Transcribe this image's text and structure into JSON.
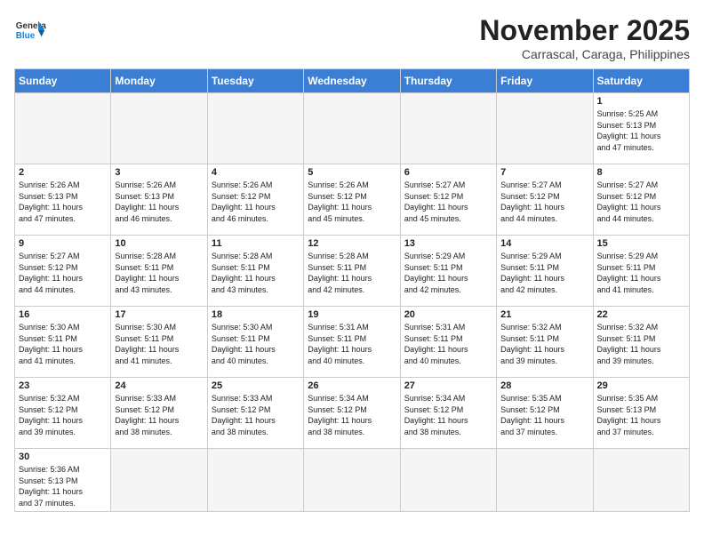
{
  "header": {
    "logo_general": "General",
    "logo_blue": "Blue",
    "month": "November 2025",
    "location": "Carrascal, Caraga, Philippines"
  },
  "weekdays": [
    "Sunday",
    "Monday",
    "Tuesday",
    "Wednesday",
    "Thursday",
    "Friday",
    "Saturday"
  ],
  "weeks": [
    [
      {
        "day": "",
        "info": ""
      },
      {
        "day": "",
        "info": ""
      },
      {
        "day": "",
        "info": ""
      },
      {
        "day": "",
        "info": ""
      },
      {
        "day": "",
        "info": ""
      },
      {
        "day": "",
        "info": ""
      },
      {
        "day": "1",
        "info": "Sunrise: 5:25 AM\nSunset: 5:13 PM\nDaylight: 11 hours\nand 47 minutes."
      }
    ],
    [
      {
        "day": "2",
        "info": "Sunrise: 5:26 AM\nSunset: 5:13 PM\nDaylight: 11 hours\nand 47 minutes."
      },
      {
        "day": "3",
        "info": "Sunrise: 5:26 AM\nSunset: 5:13 PM\nDaylight: 11 hours\nand 46 minutes."
      },
      {
        "day": "4",
        "info": "Sunrise: 5:26 AM\nSunset: 5:12 PM\nDaylight: 11 hours\nand 46 minutes."
      },
      {
        "day": "5",
        "info": "Sunrise: 5:26 AM\nSunset: 5:12 PM\nDaylight: 11 hours\nand 45 minutes."
      },
      {
        "day": "6",
        "info": "Sunrise: 5:27 AM\nSunset: 5:12 PM\nDaylight: 11 hours\nand 45 minutes."
      },
      {
        "day": "7",
        "info": "Sunrise: 5:27 AM\nSunset: 5:12 PM\nDaylight: 11 hours\nand 44 minutes."
      },
      {
        "day": "8",
        "info": "Sunrise: 5:27 AM\nSunset: 5:12 PM\nDaylight: 11 hours\nand 44 minutes."
      }
    ],
    [
      {
        "day": "9",
        "info": "Sunrise: 5:27 AM\nSunset: 5:12 PM\nDaylight: 11 hours\nand 44 minutes."
      },
      {
        "day": "10",
        "info": "Sunrise: 5:28 AM\nSunset: 5:11 PM\nDaylight: 11 hours\nand 43 minutes."
      },
      {
        "day": "11",
        "info": "Sunrise: 5:28 AM\nSunset: 5:11 PM\nDaylight: 11 hours\nand 43 minutes."
      },
      {
        "day": "12",
        "info": "Sunrise: 5:28 AM\nSunset: 5:11 PM\nDaylight: 11 hours\nand 42 minutes."
      },
      {
        "day": "13",
        "info": "Sunrise: 5:29 AM\nSunset: 5:11 PM\nDaylight: 11 hours\nand 42 minutes."
      },
      {
        "day": "14",
        "info": "Sunrise: 5:29 AM\nSunset: 5:11 PM\nDaylight: 11 hours\nand 42 minutes."
      },
      {
        "day": "15",
        "info": "Sunrise: 5:29 AM\nSunset: 5:11 PM\nDaylight: 11 hours\nand 41 minutes."
      }
    ],
    [
      {
        "day": "16",
        "info": "Sunrise: 5:30 AM\nSunset: 5:11 PM\nDaylight: 11 hours\nand 41 minutes."
      },
      {
        "day": "17",
        "info": "Sunrise: 5:30 AM\nSunset: 5:11 PM\nDaylight: 11 hours\nand 41 minutes."
      },
      {
        "day": "18",
        "info": "Sunrise: 5:30 AM\nSunset: 5:11 PM\nDaylight: 11 hours\nand 40 minutes."
      },
      {
        "day": "19",
        "info": "Sunrise: 5:31 AM\nSunset: 5:11 PM\nDaylight: 11 hours\nand 40 minutes."
      },
      {
        "day": "20",
        "info": "Sunrise: 5:31 AM\nSunset: 5:11 PM\nDaylight: 11 hours\nand 40 minutes."
      },
      {
        "day": "21",
        "info": "Sunrise: 5:32 AM\nSunset: 5:11 PM\nDaylight: 11 hours\nand 39 minutes."
      },
      {
        "day": "22",
        "info": "Sunrise: 5:32 AM\nSunset: 5:11 PM\nDaylight: 11 hours\nand 39 minutes."
      }
    ],
    [
      {
        "day": "23",
        "info": "Sunrise: 5:32 AM\nSunset: 5:12 PM\nDaylight: 11 hours\nand 39 minutes."
      },
      {
        "day": "24",
        "info": "Sunrise: 5:33 AM\nSunset: 5:12 PM\nDaylight: 11 hours\nand 38 minutes."
      },
      {
        "day": "25",
        "info": "Sunrise: 5:33 AM\nSunset: 5:12 PM\nDaylight: 11 hours\nand 38 minutes."
      },
      {
        "day": "26",
        "info": "Sunrise: 5:34 AM\nSunset: 5:12 PM\nDaylight: 11 hours\nand 38 minutes."
      },
      {
        "day": "27",
        "info": "Sunrise: 5:34 AM\nSunset: 5:12 PM\nDaylight: 11 hours\nand 38 minutes."
      },
      {
        "day": "28",
        "info": "Sunrise: 5:35 AM\nSunset: 5:12 PM\nDaylight: 11 hours\nand 37 minutes."
      },
      {
        "day": "29",
        "info": "Sunrise: 5:35 AM\nSunset: 5:13 PM\nDaylight: 11 hours\nand 37 minutes."
      }
    ],
    [
      {
        "day": "30",
        "info": "Sunrise: 5:36 AM\nSunset: 5:13 PM\nDaylight: 11 hours\nand 37 minutes."
      },
      {
        "day": "",
        "info": ""
      },
      {
        "day": "",
        "info": ""
      },
      {
        "day": "",
        "info": ""
      },
      {
        "day": "",
        "info": ""
      },
      {
        "day": "",
        "info": ""
      },
      {
        "day": "",
        "info": ""
      }
    ]
  ]
}
